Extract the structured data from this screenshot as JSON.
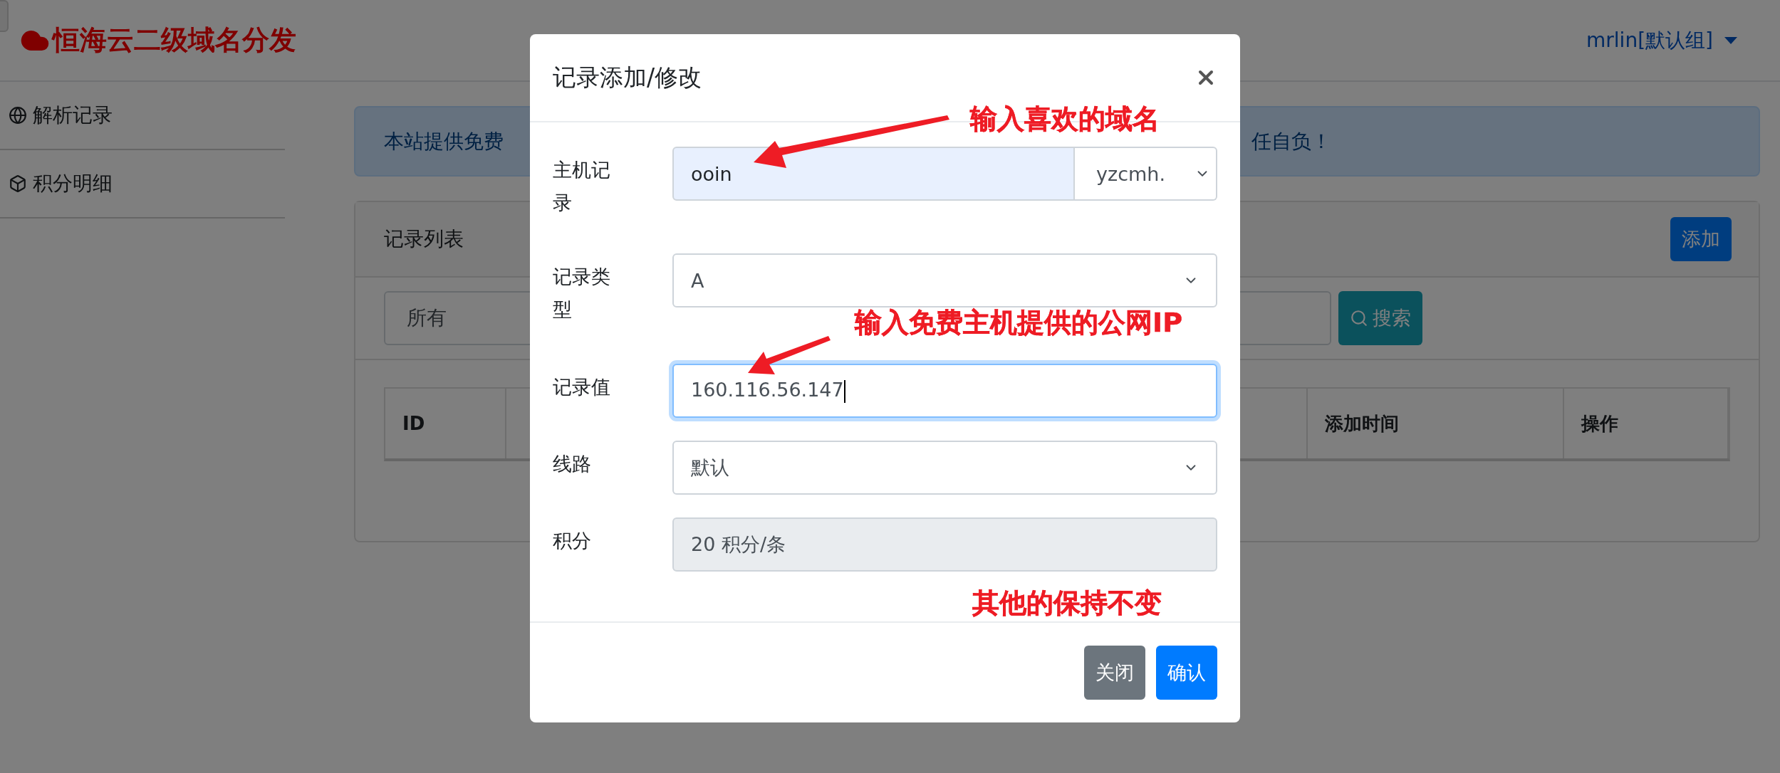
{
  "header": {
    "brand": "恒海云二级域名分发",
    "user": "mrlin[默认组]"
  },
  "sidebar": {
    "items": [
      {
        "label": "解析记录",
        "kind": "globe"
      },
      {
        "label": "积分明细",
        "kind": "cube"
      }
    ]
  },
  "alert": {
    "text_start": "本站提供免费",
    "text_end": "任自负！"
  },
  "card": {
    "title": "记录列表",
    "add_button": "添加",
    "filter_select": "所有",
    "search_button": "搜索"
  },
  "table": {
    "columns": [
      "ID",
      "",
      "添加时间",
      "操作"
    ]
  },
  "modal": {
    "title": "记录添加/修改",
    "fields": [
      {
        "label": "主机记录",
        "kind": "input_select",
        "value": "ooin",
        "select": "yzcmh.",
        "autofilled": true
      },
      {
        "label": "记录类型",
        "kind": "select",
        "value": "A"
      },
      {
        "label": "记录值",
        "kind": "input",
        "value": "160.116.56.147",
        "focused": true
      },
      {
        "label": "线路",
        "kind": "select",
        "value": "默认"
      },
      {
        "label": "积分",
        "kind": "readonly",
        "value": "20 积分/条"
      }
    ],
    "buttons": [
      {
        "label": "关闭",
        "kind": "secondary"
      },
      {
        "label": "确认",
        "kind": "primary"
      }
    ]
  },
  "annotations": [
    {
      "text": "输入喜欢的域名"
    },
    {
      "text": "输入免费主机提供的公网IP"
    },
    {
      "text": "其他的保持不变"
    }
  ]
}
